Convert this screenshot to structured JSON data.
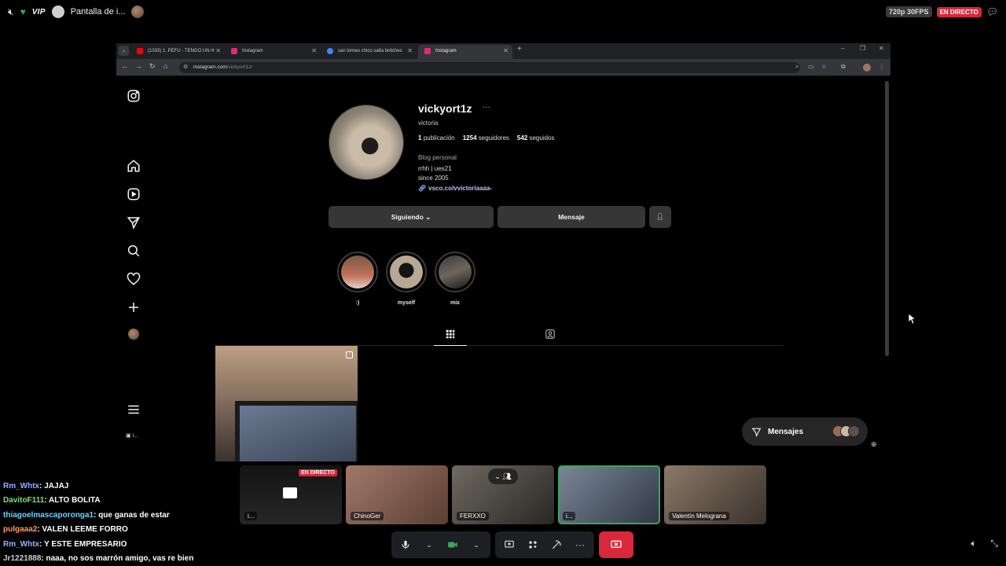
{
  "discord": {
    "vip_label": "VIP",
    "stream_title": "Pantalla de i...",
    "quality": "720p 30FPS",
    "live_label": "EN DIRECTO"
  },
  "browser": {
    "tabs": [
      {
        "label": "(1033) 1. PEFU - TENGO UN H",
        "color": "#ff0000",
        "active": false
      },
      {
        "label": "Instagram",
        "color": "#dd2a7b",
        "active": false
      },
      {
        "label": "san lorneo chico salta bolichec",
        "color": "#4285f4",
        "active": false
      },
      {
        "label": "Instagram",
        "color": "#dd2a7b",
        "active": true
      }
    ],
    "url_host": "instagram.com",
    "url_path": "/vickyort1z/"
  },
  "instagram": {
    "username": "vickyort1z",
    "full_name": "victoria",
    "stats": {
      "posts": "1",
      "posts_label": "publicación",
      "followers": "1254",
      "followers_label": "seguidores",
      "following": "542",
      "following_label": "seguidos"
    },
    "category": "Blog personal",
    "bio_line1": "rrhh | ues21",
    "bio_line2": "since 2005",
    "link": "vsco.co/vvictoriaaaa-",
    "follow_button": "Siguiendo ⌄",
    "message_button": "Mensaje",
    "highlights": [
      {
        "label": ":)"
      },
      {
        "label": "myself"
      },
      {
        "label": "mix"
      }
    ],
    "messages_pill": "Mensajes"
  },
  "chat": [
    {
      "user": "Rm_Whtx",
      "color": "#8fb3ff",
      "text": "JAJAJ"
    },
    {
      "user": "DavitoF111",
      "color": "#7fe07f",
      "text": "ALTO BOLITA"
    },
    {
      "user": "thiagoelmascaporonga1",
      "color": "#6fd0ff",
      "text": "que ganas de estar"
    },
    {
      "user": "pulgaaa2",
      "color": "#ff9a6a",
      "text": "VALEN LEEME FORRO"
    },
    {
      "user": "Rm_Whtx",
      "color": "#8fb3ff",
      "text": "Y ESTE EMPRESARIO"
    },
    {
      "user": "Jr1221888",
      "color": "#cfcfcf",
      "text": "naaa, no sos marrón amigo, vas re bien"
    }
  ],
  "participants": [
    {
      "name": "i...",
      "live": "EN DIRECTO"
    },
    {
      "name": "ChinoGer"
    },
    {
      "name": "FERXXO"
    },
    {
      "name": "i..."
    },
    {
      "name": "Valentín Melograna"
    }
  ]
}
